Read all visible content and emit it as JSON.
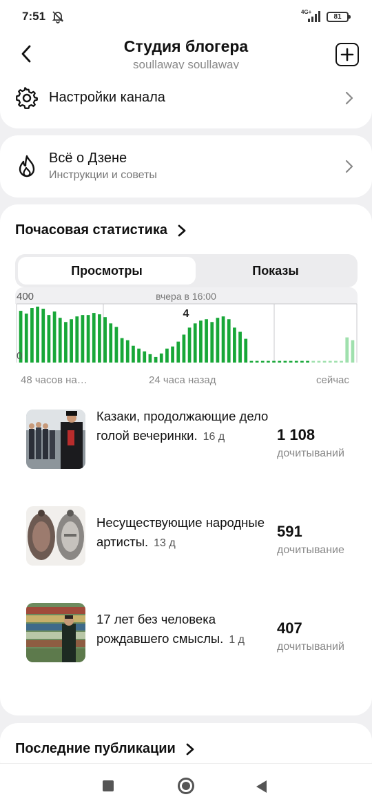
{
  "status_bar": {
    "time": "7:51",
    "network": "4G+",
    "battery": "81",
    "icons": [
      "notifications-off-icon",
      "signal-icon",
      "battery-icon"
    ]
  },
  "header": {
    "title": "Студия блогера",
    "subtitle": "soullaway soullaway",
    "back_icon": "back-arrow-icon",
    "add_icon": "add-square-icon"
  },
  "settings_row": {
    "label": "Настройки канала",
    "icon": "gear-icon"
  },
  "zen_row": {
    "label": "Всё о Дзене",
    "sublabel": "Инструкции и советы",
    "icon": "flame-icon"
  },
  "stats": {
    "title": "Почасовая статистика",
    "tabs": [
      "Просмотры",
      "Показы"
    ],
    "active_tab": "Просмотры",
    "accent_color": "#18a738",
    "faded_color": "#9fe0ad",
    "axis_labels": {
      "left": "48 часов на…",
      "middle": "24 часа назад",
      "right": "сейчас"
    }
  },
  "chart_data": {
    "type": "bar",
    "title": "",
    "ylim": [
      0,
      400
    ],
    "y_tick_labels": [
      "400",
      "0"
    ],
    "tooltip": {
      "label": "вчера в 16:00",
      "value": "4"
    },
    "values": [
      370,
      350,
      390,
      400,
      385,
      340,
      365,
      320,
      290,
      310,
      330,
      340,
      340,
      355,
      345,
      325,
      280,
      255,
      175,
      160,
      120,
      100,
      80,
      60,
      40,
      65,
      100,
      115,
      150,
      200,
      250,
      280,
      300,
      310,
      290,
      320,
      330,
      310,
      250,
      220,
      170,
      12,
      12,
      12,
      12,
      12,
      12,
      12,
      12,
      12,
      12,
      12,
      12,
      12,
      12,
      12,
      12,
      12,
      180,
      160
    ],
    "faded_from_index": 52,
    "grid": true
  },
  "articles": [
    {
      "title": "Казаки, продолжающие дело голой вечеринки.",
      "age": "16 д",
      "count": "1 108",
      "unit": "дочитываний",
      "thumb": "cossacks-photo"
    },
    {
      "title": "Несуществующие народные артисты.",
      "age": "13 д",
      "count": "591",
      "unit": "дочитывание",
      "thumb": "badge-photo"
    },
    {
      "title": "17 лет без человека рождавшего смыслы.",
      "age": "1 д",
      "count": "407",
      "unit": "дочитываний",
      "thumb": "library-photo"
    }
  ],
  "publications": {
    "title": "Последние публикации"
  },
  "nav": [
    "recents-button",
    "home-button",
    "back-button"
  ]
}
